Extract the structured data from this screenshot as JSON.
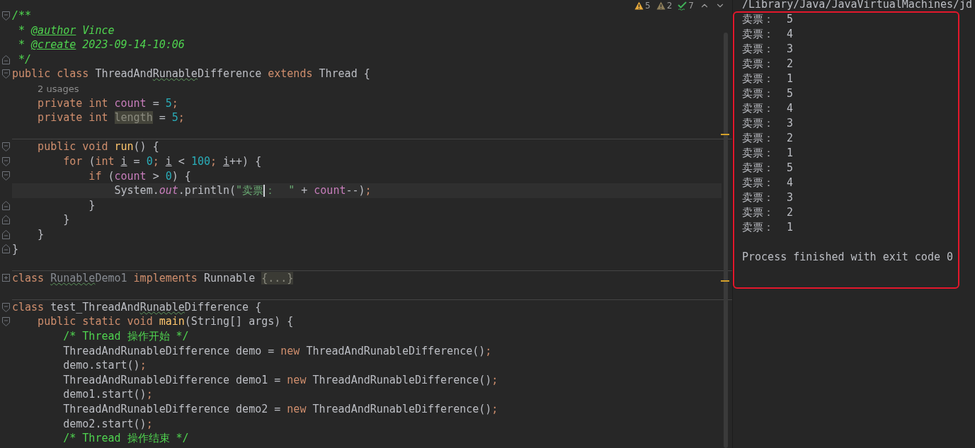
{
  "editor": {
    "inspections": [
      {
        "kind": "warning",
        "count": "5"
      },
      {
        "kind": "weak-warning",
        "count": "2"
      },
      {
        "kind": "typo",
        "count": "7"
      }
    ],
    "blocks": [
      {
        "lines": [
          {
            "kind": "code",
            "fold": {
              "kind": "start"
            },
            "current": false,
            "segments": [
              {
                "kind": "doc",
                "text": "/**"
              }
            ]
          },
          {
            "kind": "code",
            "current": false,
            "segments": [
              {
                "kind": "doc",
                "text": " * "
              },
              {
                "kind": "doctag",
                "text": "@author"
              },
              {
                "kind": "doc",
                "text": " Vince"
              }
            ]
          },
          {
            "kind": "code",
            "current": false,
            "segments": [
              {
                "kind": "doc",
                "text": " * "
              },
              {
                "kind": "doctag",
                "text": "@create"
              },
              {
                "kind": "doc",
                "text": " 2023-09-14-10:06"
              }
            ]
          },
          {
            "kind": "code",
            "fold": {
              "kind": "end"
            },
            "current": false,
            "segments": [
              {
                "kind": "doc",
                "text": " */"
              }
            ]
          },
          {
            "kind": "code",
            "fold": {
              "kind": "start"
            },
            "current": false,
            "segments": [
              {
                "kind": "keyword",
                "text": "public class "
              },
              {
                "kind": "plain",
                "text": "ThreadAnd"
              },
              {
                "kind": "typo",
                "text": "Runable"
              },
              {
                "kind": "plain",
                "text": "Difference "
              },
              {
                "kind": "keyword",
                "text": "extends "
              },
              {
                "kind": "plain",
                "text": "Thread {"
              }
            ]
          },
          {
            "kind": "hint",
            "segments": [
              {
                "kind": "hint",
                "text": "2 usages"
              }
            ]
          },
          {
            "kind": "code",
            "current": false,
            "segments": [
              {
                "kind": "keyword",
                "text": "    private int "
              },
              {
                "kind": "field",
                "text": "count"
              },
              {
                "kind": "plain",
                "text": " = "
              },
              {
                "kind": "number",
                "text": "5"
              },
              {
                "kind": "keyword",
                "text": ";"
              }
            ]
          },
          {
            "kind": "code",
            "current": false,
            "segments": [
              {
                "kind": "keyword",
                "text": "    private int "
              },
              {
                "kind": "unused-highlight",
                "text": "length"
              },
              {
                "kind": "plain",
                "text": " = "
              },
              {
                "kind": "number",
                "text": "5"
              },
              {
                "kind": "keyword",
                "text": ";"
              }
            ]
          },
          {
            "kind": "blank"
          }
        ]
      },
      {
        "lines": [
          {
            "kind": "code",
            "fold": {
              "kind": "start"
            },
            "current": false,
            "segments": [
              {
                "kind": "keyword",
                "text": "    public void "
              },
              {
                "kind": "method",
                "text": "run"
              },
              {
                "kind": "plain",
                "text": "() {"
              }
            ]
          },
          {
            "kind": "code",
            "fold": {
              "kind": "start"
            },
            "current": false,
            "segments": [
              {
                "kind": "keyword",
                "text": "        for "
              },
              {
                "kind": "plain",
                "text": "("
              },
              {
                "kind": "keyword",
                "text": "int "
              },
              {
                "kind": "underlined",
                "text": "i"
              },
              {
                "kind": "plain",
                "text": " = "
              },
              {
                "kind": "number",
                "text": "0"
              },
              {
                "kind": "keyword",
                "text": "; "
              },
              {
                "kind": "underlined",
                "text": "i"
              },
              {
                "kind": "plain",
                "text": " < "
              },
              {
                "kind": "number",
                "text": "100"
              },
              {
                "kind": "keyword",
                "text": "; "
              },
              {
                "kind": "underlined",
                "text": "i"
              },
              {
                "kind": "plain",
                "text": "++) {"
              }
            ]
          },
          {
            "kind": "code",
            "fold": {
              "kind": "start"
            },
            "current": false,
            "segments": [
              {
                "kind": "keyword",
                "text": "            if "
              },
              {
                "kind": "plain",
                "text": "("
              },
              {
                "kind": "field",
                "text": "count"
              },
              {
                "kind": "plain",
                "text": " > "
              },
              {
                "kind": "number",
                "text": "0"
              },
              {
                "kind": "plain",
                "text": ") {"
              }
            ]
          },
          {
            "kind": "code",
            "current": true,
            "segments": [
              {
                "kind": "plain",
                "text": "                System."
              },
              {
                "kind": "static-field",
                "text": "out"
              },
              {
                "kind": "plain",
                "text": ".println("
              },
              {
                "kind": "string",
                "text": "\"卖票",
                "caret": true
              },
              {
                "kind": "string",
                "text": "：  \""
              },
              {
                "kind": "plain",
                "text": " + "
              },
              {
                "kind": "field",
                "text": "count"
              },
              {
                "kind": "plain",
                "text": "--)"
              },
              {
                "kind": "keyword",
                "text": ";"
              }
            ]
          },
          {
            "kind": "code",
            "fold": {
              "kind": "end"
            },
            "current": false,
            "segments": [
              {
                "kind": "plain",
                "text": "            }"
              }
            ]
          },
          {
            "kind": "code",
            "fold": {
              "kind": "end"
            },
            "current": false,
            "segments": [
              {
                "kind": "plain",
                "text": "        }"
              }
            ]
          },
          {
            "kind": "code",
            "fold": {
              "kind": "end"
            },
            "current": false,
            "segments": [
              {
                "kind": "plain",
                "text": "    }"
              }
            ]
          },
          {
            "kind": "code",
            "fold": {
              "kind": "end"
            },
            "current": false,
            "segments": [
              {
                "kind": "plain",
                "text": "}"
              }
            ]
          },
          {
            "kind": "blank"
          }
        ]
      },
      {
        "lines": [
          {
            "kind": "code",
            "fold": {
              "kind": "collapsed"
            },
            "current": false,
            "segments": [
              {
                "kind": "keyword",
                "text": "class "
              },
              {
                "kind": "unused-typo",
                "text": "Runable"
              },
              {
                "kind": "unused",
                "text": "Demo1 "
              },
              {
                "kind": "keyword",
                "text": "implements "
              },
              {
                "kind": "plain",
                "text": "Runnable "
              },
              {
                "kind": "folded",
                "text": "{...}"
              }
            ]
          },
          {
            "kind": "blank"
          }
        ]
      },
      {
        "lines": [
          {
            "kind": "code",
            "fold": {
              "kind": "start"
            },
            "current": false,
            "segments": [
              {
                "kind": "keyword",
                "text": "class "
              },
              {
                "kind": "plain",
                "text": "test_ThreadAnd"
              },
              {
                "kind": "typo",
                "text": "Runable"
              },
              {
                "kind": "plain",
                "text": "Difference {"
              }
            ]
          },
          {
            "kind": "code",
            "fold": {
              "kind": "start"
            },
            "current": false,
            "segments": [
              {
                "kind": "keyword",
                "text": "    public static void "
              },
              {
                "kind": "method",
                "text": "main"
              },
              {
                "kind": "plain",
                "text": "(String[] args) {"
              }
            ]
          },
          {
            "kind": "code",
            "current": false,
            "segments": [
              {
                "kind": "comment",
                "text": "        /* Thread 操作开始 */"
              }
            ]
          },
          {
            "kind": "code",
            "current": false,
            "segments": [
              {
                "kind": "plain",
                "text": "        ThreadAndRunableDifference demo = "
              },
              {
                "kind": "keyword",
                "text": "new "
              },
              {
                "kind": "plain",
                "text": "ThreadAndRunableDifference()"
              },
              {
                "kind": "keyword",
                "text": ";"
              }
            ]
          },
          {
            "kind": "code",
            "current": false,
            "segments": [
              {
                "kind": "plain",
                "text": "        demo.start()"
              },
              {
                "kind": "keyword",
                "text": ";"
              }
            ]
          },
          {
            "kind": "code",
            "current": false,
            "segments": [
              {
                "kind": "plain",
                "text": "        ThreadAndRunableDifference demo1 = "
              },
              {
                "kind": "keyword",
                "text": "new "
              },
              {
                "kind": "plain",
                "text": "ThreadAndRunableDifference()"
              },
              {
                "kind": "keyword",
                "text": ";"
              }
            ]
          },
          {
            "kind": "code",
            "current": false,
            "segments": [
              {
                "kind": "plain",
                "text": "        demo1.start()"
              },
              {
                "kind": "keyword",
                "text": ";"
              }
            ]
          },
          {
            "kind": "code",
            "current": false,
            "segments": [
              {
                "kind": "plain",
                "text": "        ThreadAndRunableDifference demo2 = "
              },
              {
                "kind": "keyword",
                "text": "new "
              },
              {
                "kind": "plain",
                "text": "ThreadAndRunableDifference()"
              },
              {
                "kind": "keyword",
                "text": ";"
              }
            ]
          },
          {
            "kind": "code",
            "current": false,
            "segments": [
              {
                "kind": "plain",
                "text": "        demo2.start()"
              },
              {
                "kind": "keyword",
                "text": ";"
              }
            ]
          },
          {
            "kind": "code",
            "current": false,
            "segments": [
              {
                "kind": "comment",
                "text": "        /* Thread 操作结束 */"
              }
            ]
          }
        ]
      }
    ]
  },
  "console": {
    "command": "/Library/Java/JavaVirtualMachines/jd",
    "lines": [
      {
        "kind": "output",
        "text": "卖票：  5"
      },
      {
        "kind": "output",
        "text": "卖票：  4"
      },
      {
        "kind": "output",
        "text": "卖票：  3"
      },
      {
        "kind": "output",
        "text": "卖票：  2"
      },
      {
        "kind": "output",
        "text": "卖票：  1"
      },
      {
        "kind": "output",
        "text": "卖票：  5"
      },
      {
        "kind": "output",
        "text": "卖票：  4"
      },
      {
        "kind": "output",
        "text": "卖票：  3"
      },
      {
        "kind": "output",
        "text": "卖票：  2"
      },
      {
        "kind": "output",
        "text": "卖票：  1"
      },
      {
        "kind": "output",
        "text": "卖票：  5"
      },
      {
        "kind": "output",
        "text": "卖票：  4"
      },
      {
        "kind": "output",
        "text": "卖票：  3"
      },
      {
        "kind": "output",
        "text": "卖票：  2"
      },
      {
        "kind": "output",
        "text": "卖票：  1"
      },
      {
        "kind": "exit",
        "text": "Process finished with exit code 0"
      }
    ]
  }
}
